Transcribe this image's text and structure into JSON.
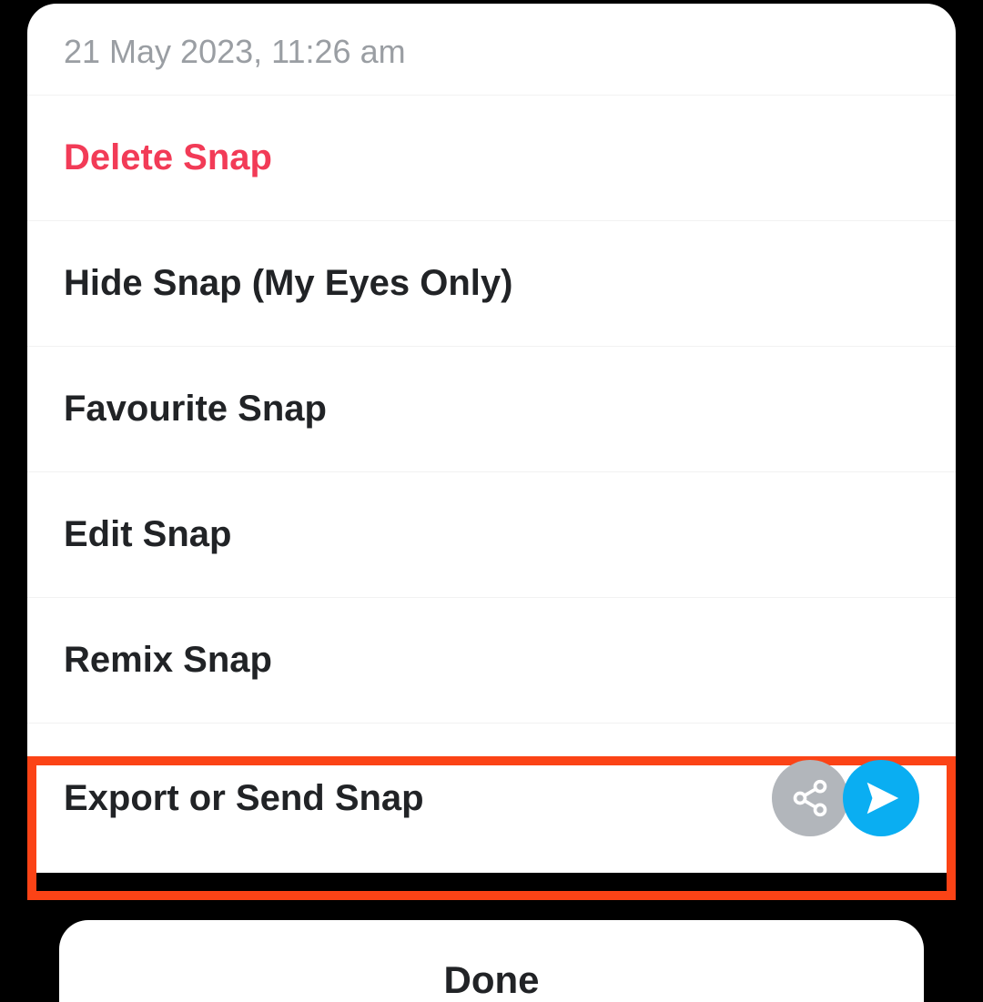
{
  "timestamp": "21 May 2023, 11:26 am",
  "menu": {
    "delete": "Delete Snap",
    "hide": "Hide Snap (My Eyes Only)",
    "favourite": "Favourite Snap",
    "edit": "Edit Snap",
    "remix": "Remix Snap",
    "export": "Export or Send Snap"
  },
  "done": "Done",
  "colors": {
    "danger": "#f23b57",
    "send": "#0aaef2",
    "share": "#b2b6bb",
    "highlight": "#fb4316"
  }
}
